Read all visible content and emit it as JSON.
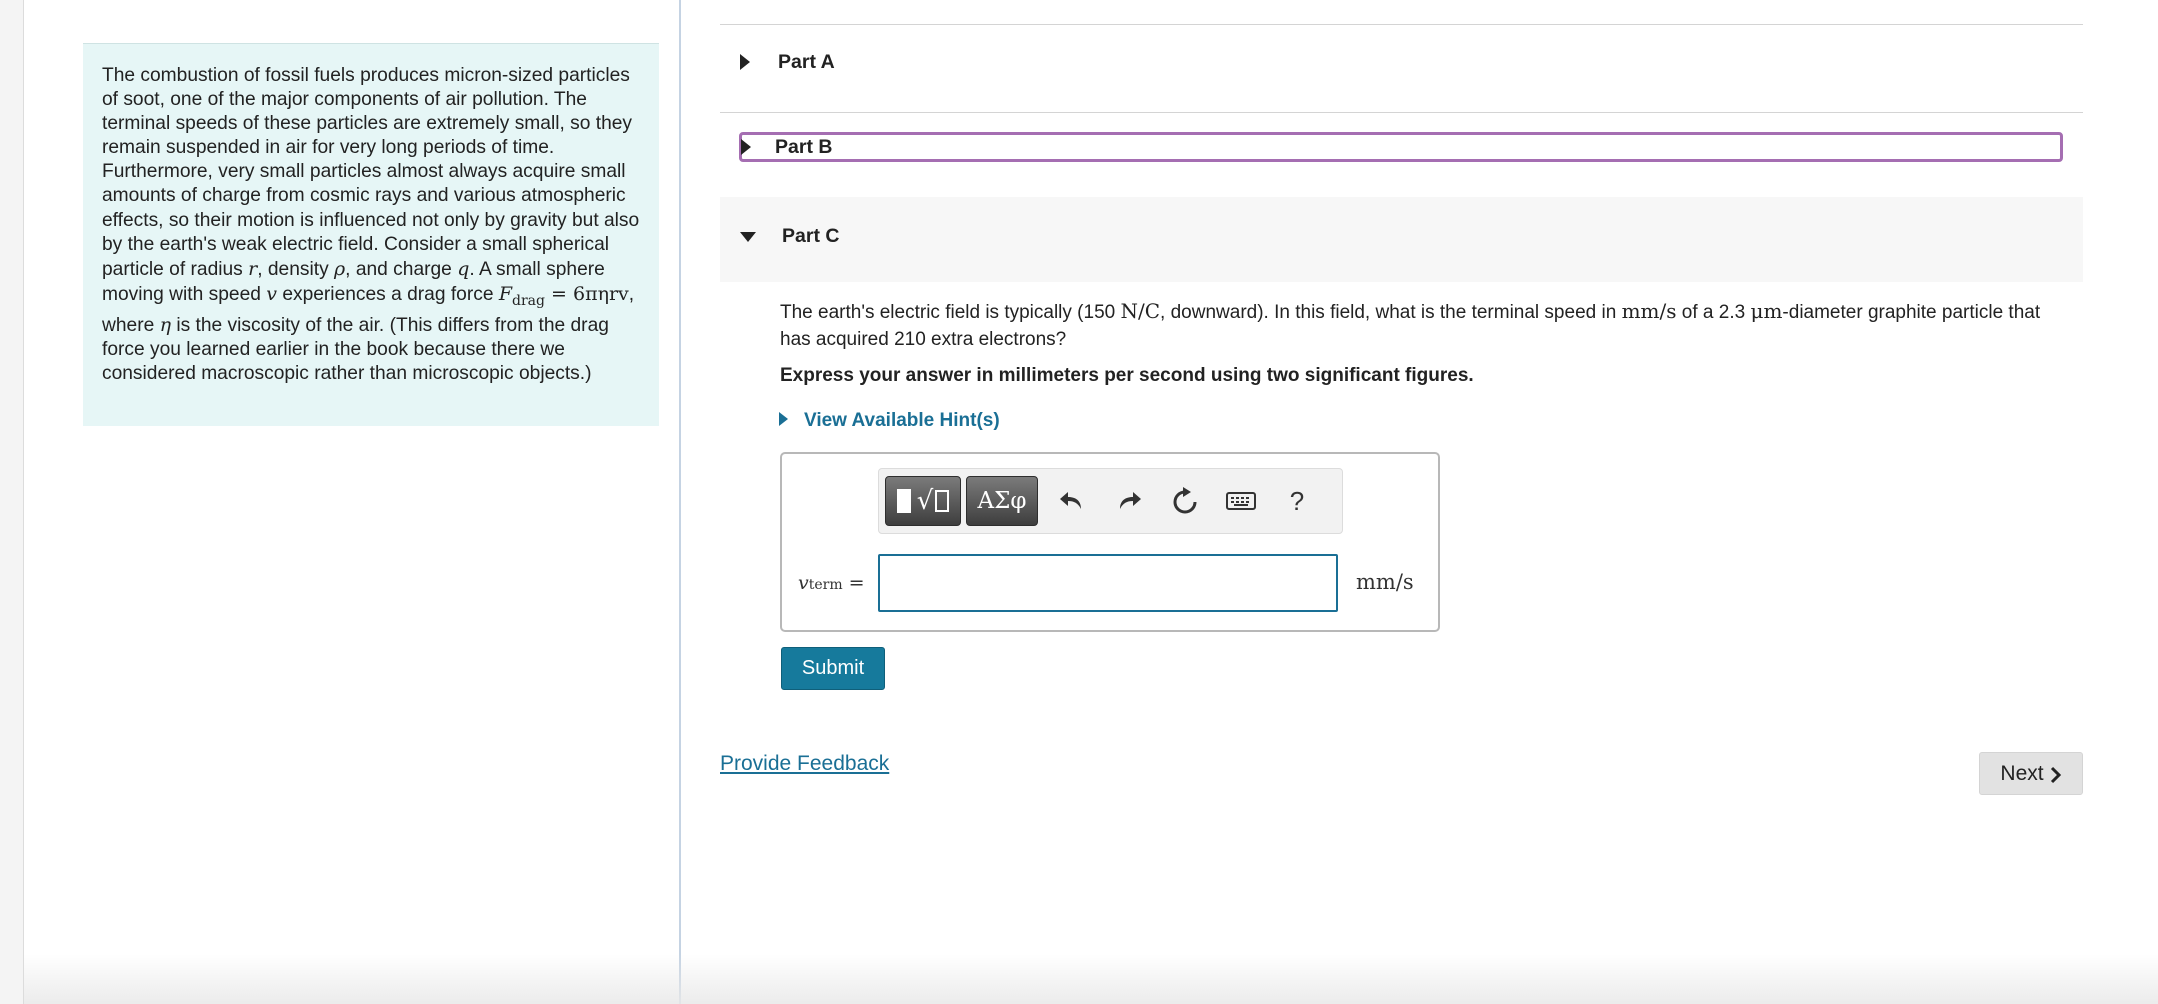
{
  "intro": {
    "p1": "The combustion of fossil fuels produces micron-sized particles of soot, one of the major components of air pollution. The terminal speeds of these particles are extremely small, so they remain suspended in air for very long periods of time. Furthermore, very small particles almost always acquire small amounts of charge from cosmic rays and various atmospheric effects, so their motion is influenced not only by gravity but also by the earth's weak electric field. Consider a small spherical particle of radius ",
    "r": "r",
    "p2": ", density ",
    "rho": "ρ",
    "p3": ", and charge ",
    "q": "q",
    "p4": ". A small sphere moving with speed ",
    "v": "v",
    "p5": " experiences a drag force ",
    "F": "F",
    "drag_sub": "drag",
    "eq": " = 6πηrv",
    "p6": ", where ",
    "eta": "η",
    "p7": " is the viscosity of the air. (This differs from the drag force you learned earlier in the book because there we considered macroscopic rather than microscopic objects.)"
  },
  "parts": {
    "a": "Part A",
    "b": "Part B",
    "c": "Part C"
  },
  "question": {
    "t1": "The earth's electric field is typically (150 ",
    "field_unit": "N/C",
    "t2": ", downward). In this field, what is the terminal speed in ",
    "speed_unit": "mm/s",
    "t3": " of a 2.3 ",
    "um": "μm",
    "t4": "-diameter graphite particle that has acquired 210 extra electrons?",
    "instruction": "Express your answer in millimeters per second using two significant figures."
  },
  "hint_label": "View Available Hint(s)",
  "answer": {
    "var": "v",
    "var_sub": "term",
    "equals": " =",
    "value": "",
    "unit": "mm/s",
    "greek_label": "ΑΣφ",
    "help_label": "?"
  },
  "submit_label": "Submit",
  "feedback_label": "Provide Feedback",
  "next_label": "Next"
}
